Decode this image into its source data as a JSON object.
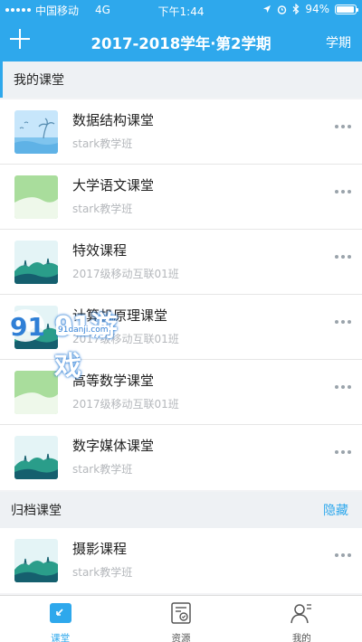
{
  "status_bar": {
    "carrier": "中国移动",
    "network": "4G",
    "time": "下午1:44",
    "battery": "94%",
    "battery_level": 0.94
  },
  "nav": {
    "title": "2017-2018学年·第2学期",
    "term_button": "学期"
  },
  "my_section": {
    "title": "我的课堂",
    "courses": [
      {
        "name": "数据结构课堂",
        "class_name": "stark教学班",
        "thumb": "beach"
      },
      {
        "name": "大学语文课堂",
        "class_name": "stark教学班",
        "thumb": "green"
      },
      {
        "name": "特效课程",
        "class_name": "2017级移动互联01班",
        "thumb": "mountain"
      },
      {
        "name": "计算机原理课堂",
        "class_name": "2017级移动互联01班",
        "thumb": "mountain"
      },
      {
        "name": "高等数学课堂",
        "class_name": "2017级移动互联01班",
        "thumb": "green"
      },
      {
        "name": "数字媒体课堂",
        "class_name": "stark教学班",
        "thumb": "mountain"
      }
    ]
  },
  "archive_section": {
    "title": "归档课堂",
    "action": "隐藏",
    "courses": [
      {
        "name": "摄影课程",
        "class_name": "stark教学班",
        "thumb": "mountain"
      }
    ]
  },
  "watermark": {
    "brand": "91游戏",
    "site": "91danji.com"
  },
  "tabs": [
    {
      "label": "课堂",
      "icon": "classroom-icon",
      "active": true
    },
    {
      "label": "资源",
      "icon": "resources-icon",
      "active": false
    },
    {
      "label": "我的",
      "icon": "profile-icon",
      "active": false
    }
  ],
  "colors": {
    "accent": "#2ea8ec",
    "text": "#222222",
    "subtext": "#b5b8bc"
  }
}
